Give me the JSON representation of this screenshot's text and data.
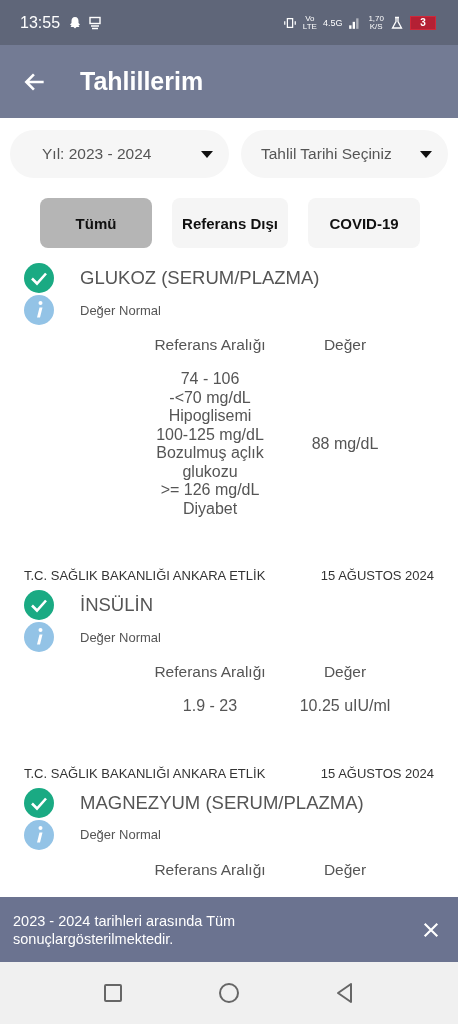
{
  "status_bar": {
    "time": "13:55",
    "volte": [
      "Vo",
      "LTE"
    ],
    "network": "4.5G",
    "speed": [
      "1,70",
      "K/S"
    ],
    "battery": "3"
  },
  "app_bar": {
    "title": "Tahlillerim"
  },
  "filters": [
    {
      "value": "Yıl: 2023 - 2024"
    },
    {
      "value": "Tahlil Tarihi Seçiniz"
    }
  ],
  "tabs": [
    {
      "label": "Tümü",
      "selected": true
    },
    {
      "label": "Referans Dışı",
      "selected": false
    },
    {
      "label": "COVID-19",
      "selected": false
    }
  ],
  "results": [
    {
      "name": "GLUKOZ (SERUM/PLAZMA)",
      "status": "Değer Normal",
      "headers": [
        "Referans Aralığı",
        "Değer"
      ],
      "range": [
        "74 - 106",
        "-<70 mg/dL",
        "Hipoglisemi",
        "100-125 mg/dL",
        "Bozulmuş açlık glukozu",
        ">= 126 mg/dL",
        "Diyabet"
      ],
      "value": "88 mg/dL"
    },
    {
      "hospital": "T.C. SAĞLIK BAKANLIĞI ANKARA ETLİK",
      "date": "15 AĞUSTOS 2024",
      "name": "İNSÜLİN",
      "status": "Değer Normal",
      "headers": [
        "Referans Aralığı",
        "Değer"
      ],
      "range": [
        "1.9 - 23"
      ],
      "value": "10.25 uIU/ml"
    },
    {
      "hospital": "T.C. SAĞLIK BAKANLIĞI ANKARA ETLİK",
      "date": "15 AĞUSTOS 2024",
      "name": "MAGNEZYUM (SERUM/PLAZMA)",
      "status": "Değer Normal",
      "headers": [
        "Referans Aralığı",
        "Değer"
      ]
    }
  ],
  "snackbar": {
    "message": "2023 - 2024 tarihleri arasında Tüm sonuçlargösterilmektedir."
  }
}
